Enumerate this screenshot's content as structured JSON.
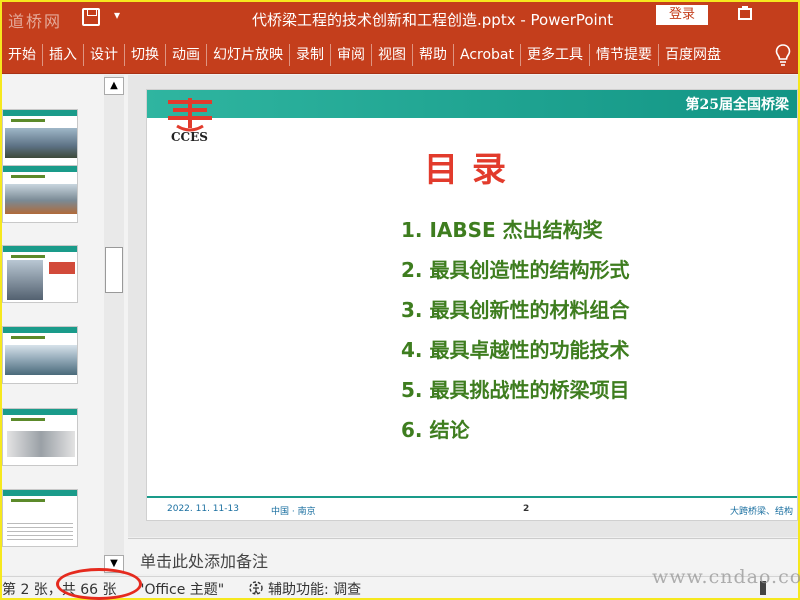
{
  "window": {
    "watermark": "道桥网",
    "title": "代桥梁工程的技术创新和工程创造.pptx  -  PowerPoint",
    "login_label": "登录"
  },
  "ribbon": {
    "tabs": [
      "开始",
      "插入",
      "设计",
      "切换",
      "动画",
      "幻灯片放映",
      "录制",
      "审阅",
      "视图",
      "帮助",
      "Acrobat",
      "更多工具",
      "情节提要",
      "百度网盘"
    ]
  },
  "slide": {
    "header": "第25届全国桥梁",
    "logo_text": "CCES",
    "title": "目录",
    "toc": [
      "1. IABSE 杰出结构奖",
      "2. 最具创造性的结构形式",
      "3. 最具创新性的材料组合",
      "4. 最具卓越性的功能技术",
      "5. 最具挑战性的桥梁项目",
      "6. 结论"
    ],
    "footer": {
      "date": "2022. 11. 11-13",
      "place": "中国 · 南京",
      "page": "2",
      "right": "大跨桥梁、结构"
    }
  },
  "notes": {
    "placeholder": "单击此处添加备注"
  },
  "status": {
    "slide_count": "第 2 张，共 66 张",
    "theme": "\"Office 主题\"",
    "accessibility": "辅助功能: 调查"
  },
  "site_watermark": "www.cndao.com",
  "colors": {
    "ribbon": "#c43e1c",
    "teal": "#1a9b8a",
    "title_red": "#e23b2c",
    "toc_green": "#3e7d1f",
    "highlight_circle": "#e52a1e"
  }
}
